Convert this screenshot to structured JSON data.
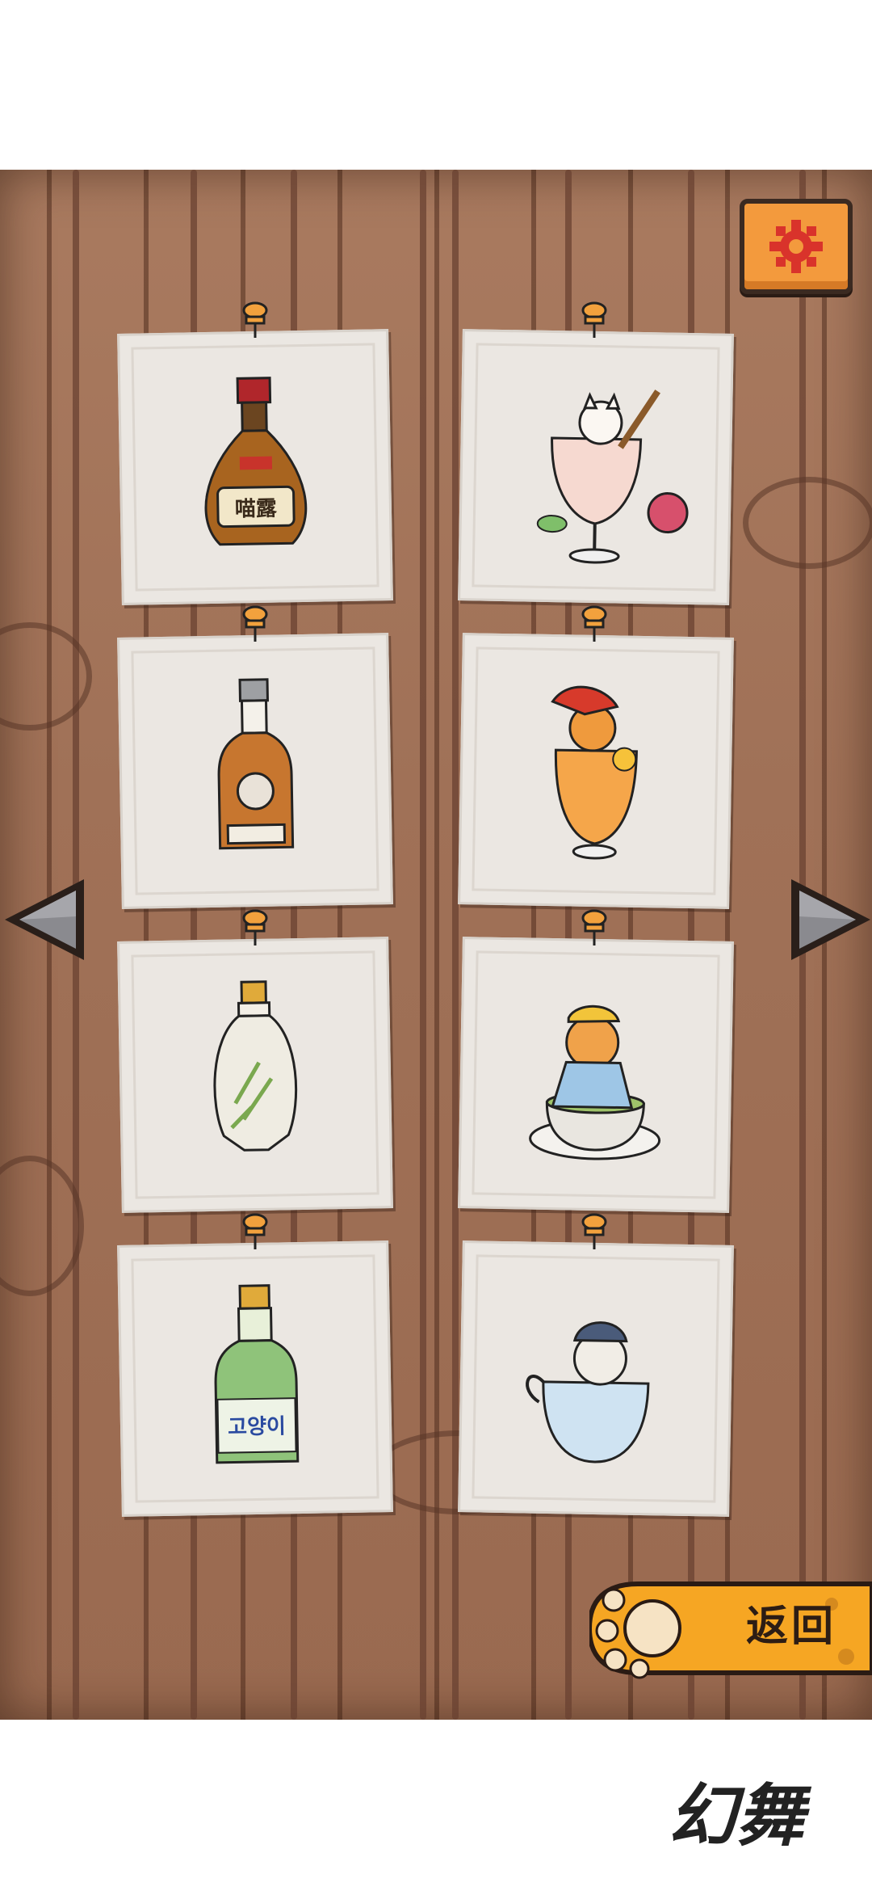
{
  "header": {},
  "settings": {
    "icon": "gear-icon",
    "accent": "#f39a3d"
  },
  "navigation": {
    "prev_icon": "triangle-left-icon",
    "next_icon": "triangle-right-icon"
  },
  "cards": [
    {
      "id": "card-1",
      "item": "miaolu-bottle",
      "label_text": "喵露"
    },
    {
      "id": "card-2",
      "item": "cat-in-glass-guitar",
      "label_text": ""
    },
    {
      "id": "card-3",
      "item": "cat-whisky-bottle",
      "label_text": ""
    },
    {
      "id": "card-4",
      "item": "cat-in-orange-drink",
      "label_text": ""
    },
    {
      "id": "card-5",
      "item": "bamboo-vase-bottle",
      "label_text": ""
    },
    {
      "id": "card-6",
      "item": "cat-in-teacup",
      "label_text": ""
    },
    {
      "id": "card-7",
      "item": "soju-bottle",
      "label_text": "고양이"
    },
    {
      "id": "card-8",
      "item": "cat-in-blue-cup",
      "label_text": ""
    }
  ],
  "back_button": {
    "label": "返回",
    "icon": "paw-icon",
    "color": "#f6a623"
  },
  "watermark": "幻舞"
}
